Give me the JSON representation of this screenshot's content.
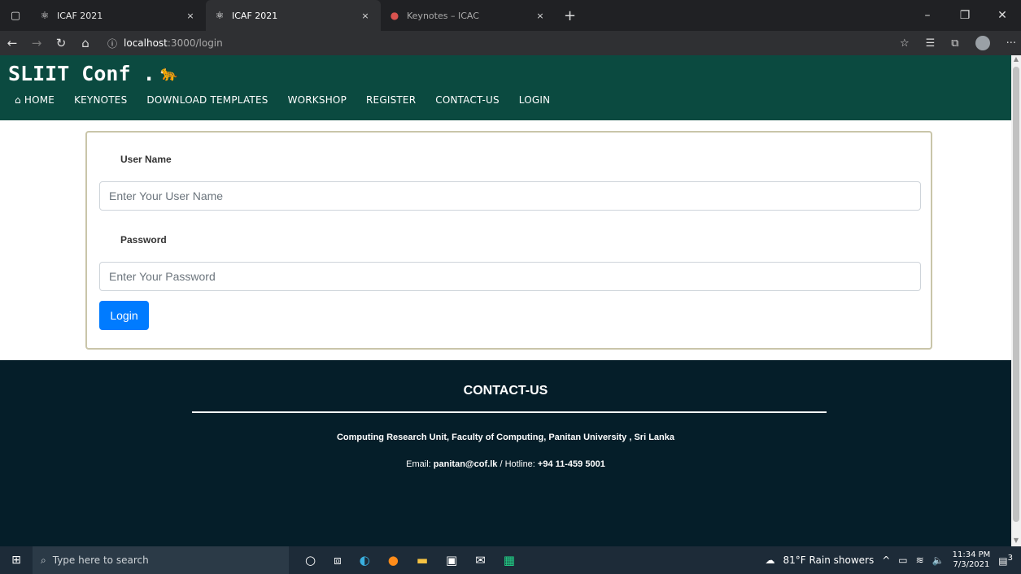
{
  "browser": {
    "tabs": [
      {
        "title": "ICAF 2021",
        "close": "×"
      },
      {
        "title": "ICAF 2021",
        "close": "×"
      },
      {
        "title": "Keynotes – ICAC",
        "close": "×"
      }
    ],
    "new_tab": "+",
    "url_host": "localhost",
    "url_path": ":3000/login",
    "window_controls": {
      "minimize": "–",
      "restore": "❐",
      "close": "✕"
    }
  },
  "site": {
    "brand": "SLIIT Conf .",
    "menu": [
      "HOME",
      "KEYNOTES",
      "DOWNLOAD TEMPLATES",
      "WORKSHOP",
      "REGISTER",
      "CONTACT-US",
      "LOGIN"
    ]
  },
  "form": {
    "username_label": "User Name",
    "username_placeholder": "Enter Your User Name",
    "password_label": "Password",
    "password_placeholder": "Enter Your Password",
    "login_button": "Login"
  },
  "footer": {
    "heading": "CONTACT-US",
    "address": "Computing Research Unit, Faculty of Computing, Panitan University , Sri Lanka",
    "email_label": "Email:",
    "email": "panitan@cof.lk",
    "separator": "/",
    "hotline_label": "Hotline:",
    "hotline": "+94 11-459 5001"
  },
  "taskbar": {
    "search_placeholder": "Type here to search",
    "weather": "81°F  Rain showers",
    "time": "11:34 PM",
    "date": "7/3/2021",
    "notifications": "3"
  },
  "colors": {
    "header_bg": "#0b4a40",
    "footer_bg": "#051e29",
    "button_bg": "#007bff",
    "card_border": "#c9c5a9"
  }
}
